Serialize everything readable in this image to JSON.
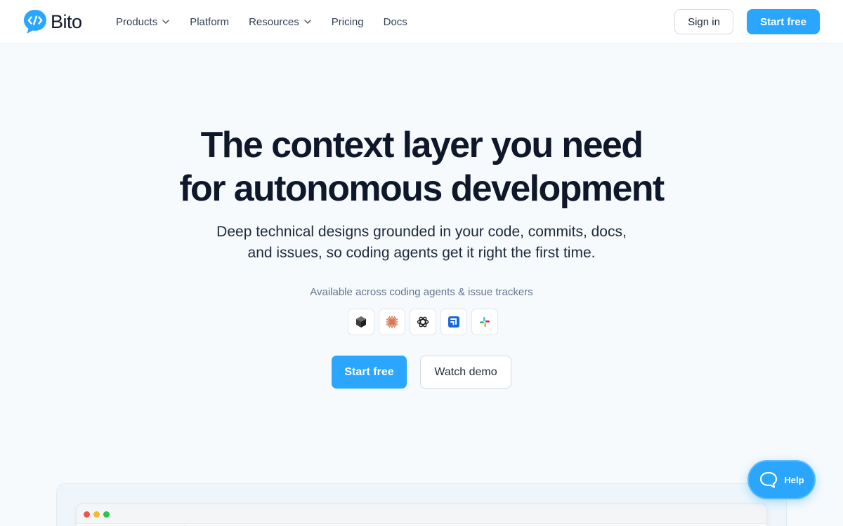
{
  "brand": {
    "name": "Bito",
    "color": "#2aa6ff"
  },
  "nav": {
    "items": [
      {
        "label": "Products",
        "has_dropdown": true
      },
      {
        "label": "Platform",
        "has_dropdown": false
      },
      {
        "label": "Resources",
        "has_dropdown": true
      },
      {
        "label": "Pricing",
        "has_dropdown": false
      },
      {
        "label": "Docs",
        "has_dropdown": false
      }
    ],
    "sign_in": "Sign in",
    "start_free": "Start free"
  },
  "hero": {
    "title_line1": "The context layer you need",
    "title_line2": "for autonomous development",
    "subtitle_line1": "Deep technical designs grounded in your code, commits, docs,",
    "subtitle_line2": "and issues, so coding agents get it right the first time.",
    "available": "Available across coding agents & issue trackers",
    "integrations": [
      "cursor-icon",
      "claude-icon",
      "openai-icon",
      "jira-icon",
      "slack-icon"
    ],
    "primary_cta": "Start free",
    "secondary_cta": "Watch demo"
  },
  "help": {
    "label": "Help"
  }
}
